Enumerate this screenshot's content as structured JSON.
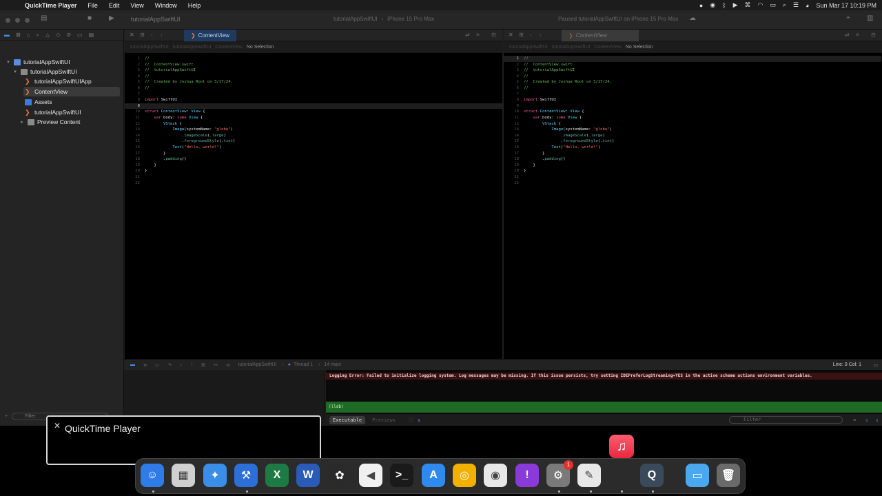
{
  "menubar": {
    "app_name": "QuickTime Player",
    "menus": [
      "File",
      "Edit",
      "View",
      "Window",
      "Help"
    ],
    "clock": "Sun Mar 17  10:19 PM"
  },
  "toolbar": {
    "project": "tutorialAppSwiftUI",
    "scheme_target": "tutorialAppSwiftUI",
    "device": "iPhone 15 Pro Max",
    "status": "Paused tutorialAppSwiftUI on iPhone 15 Pro Max"
  },
  "navigator": {
    "items": [
      {
        "label": "tutorialAppSwiftUI",
        "icon": "project-icon",
        "disclosure": "▾"
      },
      {
        "label": "tutorialAppSwiftUI",
        "icon": "folder-icon",
        "disclosure": "▾"
      },
      {
        "label": "tutorialAppSwiftUIApp",
        "icon": "swift-file-icon",
        "disclosure": ""
      },
      {
        "label": "ContentView",
        "icon": "swift-file-icon",
        "disclosure": ""
      },
      {
        "label": "Assets",
        "icon": "asset-catalog-icon",
        "disclosure": ""
      },
      {
        "label": "tutorialAppSwiftUI",
        "icon": "swift-file-icon",
        "disclosure": ""
      },
      {
        "label": "Preview Content",
        "icon": "folder-icon",
        "disclosure": "▸"
      }
    ],
    "filter_placeholder": "Filter"
  },
  "editor_left": {
    "tab": "ContentView",
    "jump": [
      "tutorialAppSwiftUI",
      "tutorialAppSwiftUI",
      "ContentView",
      "No Selection"
    ]
  },
  "editor_right": {
    "tab": "ContentView",
    "jump": [
      "tutorialAppSwiftUI",
      "tutorialAppSwiftUI",
      "ContentView",
      "No Selection"
    ]
  },
  "code_lines": [
    [
      [
        "c-cm",
        "//"
      ]
    ],
    [
      [
        "c-cm",
        "//  ContentView.swift"
      ]
    ],
    [
      [
        "c-cm",
        "//  tutorialAppSwiftUI"
      ]
    ],
    [
      [
        "c-cm",
        "//"
      ]
    ],
    [
      [
        "c-cm",
        "//  Created by Joshua Root on 3/17/24."
      ]
    ],
    [
      [
        "c-cm",
        "//"
      ]
    ],
    [],
    [
      [
        "c-kw",
        "import"
      ],
      [
        "c-plain",
        " SwiftUI"
      ]
    ],
    [],
    [
      [
        "c-kw",
        "struct"
      ],
      [
        "c-plain",
        " "
      ],
      [
        "c-ty",
        "ContentView"
      ],
      [
        "c-plain",
        ": "
      ],
      [
        "c-ty",
        "View"
      ],
      [
        "c-plain",
        " {"
      ]
    ],
    [
      [
        "c-plain",
        "    "
      ],
      [
        "c-kw",
        "var"
      ],
      [
        "c-plain",
        " body: "
      ],
      [
        "c-kw",
        "some"
      ],
      [
        "c-plain",
        " "
      ],
      [
        "c-ty",
        "View"
      ],
      [
        "c-plain",
        " {"
      ]
    ],
    [
      [
        "c-plain",
        "        "
      ],
      [
        "c-ty",
        "VStack"
      ],
      [
        "c-plain",
        " {"
      ]
    ],
    [
      [
        "c-plain",
        "            "
      ],
      [
        "c-ty",
        "Image"
      ],
      [
        "c-plain",
        "(systemName: "
      ],
      [
        "c-st",
        "\"globe\""
      ],
      [
        "c-plain",
        ")"
      ]
    ],
    [
      [
        "c-plain",
        "                ."
      ],
      [
        "c-fn",
        "imageScale"
      ],
      [
        "c-plain",
        "(."
      ],
      [
        "c-fn",
        "large"
      ],
      [
        "c-plain",
        ")"
      ]
    ],
    [
      [
        "c-plain",
        "                ."
      ],
      [
        "c-fn",
        "foregroundStyle"
      ],
      [
        "c-plain",
        "(."
      ],
      [
        "c-fn",
        "tint"
      ],
      [
        "c-plain",
        ")"
      ]
    ],
    [
      [
        "c-plain",
        "            "
      ],
      [
        "c-ty",
        "Text"
      ],
      [
        "c-plain",
        "("
      ],
      [
        "c-st",
        "\"Hello, world!\""
      ],
      [
        "c-plain",
        ")"
      ]
    ],
    [
      [
        "c-plain",
        "        }"
      ]
    ],
    [
      [
        "c-plain",
        "        ."
      ],
      [
        "c-fn",
        "padding"
      ],
      [
        "c-plain",
        "()"
      ]
    ],
    [
      [
        "c-plain",
        "    }"
      ]
    ],
    [
      [
        "c-plain",
        "}"
      ]
    ],
    [],
    []
  ],
  "debug": {
    "target": "tutorialAppSwiftUI",
    "thread": "Thread 1",
    "frame": "14 main",
    "cursor": "Line: 9  Col: 1"
  },
  "console": {
    "error": "Logging Error: Failed to initialize logging system. Log messages may be missing. If this issue persists, try setting IDEPreferLogStreaming=YES in the active scheme actions environment variables.",
    "prompt": "(lldb)",
    "tab_executable": "Executable",
    "tab_previews": "Previews",
    "filter_placeholder": "Filter"
  },
  "notification": {
    "title": "QuickTime Player"
  },
  "dock": {
    "apps": [
      {
        "name": "Finder",
        "icon": "finder-icon",
        "color": "#2f7be8",
        "glyph": "☺"
      },
      {
        "name": "Launchpad",
        "icon": "launchpad-icon",
        "color": "#d0d0d0",
        "glyph": "▦"
      },
      {
        "name": "Safari",
        "icon": "safari-icon",
        "color": "#3a8ee8",
        "glyph": "✦"
      },
      {
        "name": "Xcode",
        "icon": "xcode-icon",
        "color": "#2c6fd8",
        "glyph": "⚒"
      },
      {
        "name": "Excel",
        "icon": "excel-icon",
        "color": "#1e7a44",
        "glyph": "X"
      },
      {
        "name": "Word",
        "icon": "word-icon",
        "color": "#2a5bb8",
        "glyph": "W"
      },
      {
        "name": "PyCharm",
        "icon": "pycharm-icon",
        "color": "#2a2a2a",
        "glyph": "✿"
      },
      {
        "name": "Visual Studio",
        "icon": "visual-studio-icon",
        "color": "#f0f0f0",
        "glyph": "◀"
      },
      {
        "name": "Terminal",
        "icon": "terminal-icon",
        "color": "#1a1a1a",
        "glyph": ">_"
      },
      {
        "name": "App Store",
        "icon": "app-store-icon",
        "color": "#2f8af0",
        "glyph": "A"
      },
      {
        "name": "Chromium",
        "icon": "chromium-icon",
        "color": "#f2b000",
        "glyph": "◎"
      },
      {
        "name": "Chrome",
        "icon": "chrome-icon",
        "color": "#e8e8e8",
        "glyph": "◉"
      },
      {
        "name": "Feedback Assistant",
        "icon": "feedback-icon",
        "color": "#8a3ad8",
        "glyph": "!"
      },
      {
        "name": "System Settings",
        "icon": "settings-icon",
        "color": "#7a7a7a",
        "glyph": "⚙",
        "badge": "1"
      },
      {
        "name": "TextEdit",
        "icon": "textedit-icon",
        "color": "#e8e8e8",
        "glyph": "✎"
      },
      {
        "name": "QuickTime Player",
        "icon": "quicktime-icon",
        "color": "#3a4a5a",
        "glyph": "Q"
      },
      {
        "name": "Downloads",
        "icon": "folder-icon",
        "color": "#4aa8f0",
        "glyph": "▭"
      },
      {
        "name": "Trash",
        "icon": "trash-icon",
        "color": "#6a6a6a",
        "glyph": "🗑"
      }
    ]
  }
}
